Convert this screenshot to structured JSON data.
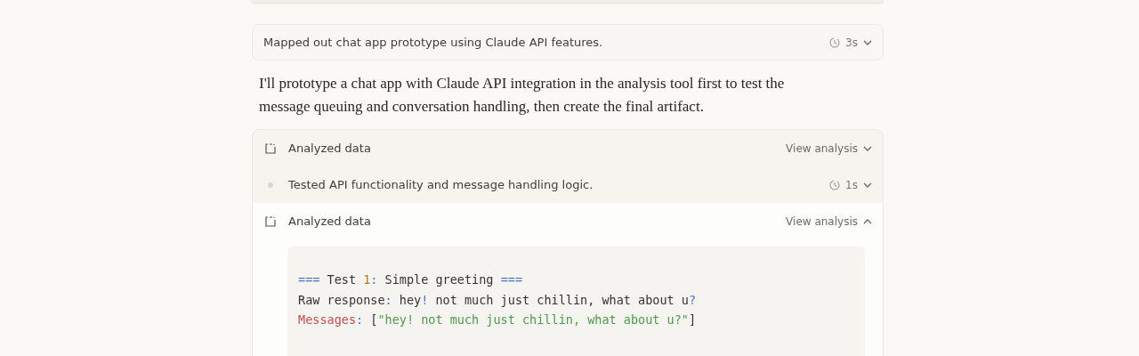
{
  "thinking": {
    "summary": "Mapped out chat app prototype using Claude API features.",
    "duration": "3s",
    "expanded": false
  },
  "message": "I'll prototype a chat app with Claude API integration in the analysis tool first to test the message queuing and conversation handling, then create the final artifact.",
  "steps": [
    {
      "kind": "analysis",
      "label": "Analyzed data",
      "action": "View analysis",
      "expanded": false
    },
    {
      "kind": "thought",
      "label": "Tested API functionality and message handling logic.",
      "duration": "1s",
      "expanded": false
    },
    {
      "kind": "analysis",
      "label": "Analyzed data",
      "action": "View analysis",
      "expanded": true
    }
  ],
  "output": [
    [
      {
        "kind": "op",
        "text": "==="
      },
      {
        "kind": "plain",
        "text": " Test "
      },
      {
        "kind": "number",
        "text": "1"
      },
      {
        "kind": "op",
        "text": ":"
      },
      {
        "kind": "plain",
        "text": " Simple greeting "
      },
      {
        "kind": "op",
        "text": "==="
      }
    ],
    [
      {
        "kind": "plain",
        "text": "Raw response"
      },
      {
        "kind": "op",
        "text": ":"
      },
      {
        "kind": "plain",
        "text": " hey"
      },
      {
        "kind": "op",
        "text": "!"
      },
      {
        "kind": "plain",
        "text": " not much just chillin, what about u"
      },
      {
        "kind": "op",
        "text": "?"
      }
    ],
    [
      {
        "kind": "key",
        "text": "Messages"
      },
      {
        "kind": "op",
        "text": ":"
      },
      {
        "kind": "plain",
        "text": " ["
      },
      {
        "kind": "string",
        "text": "\"hey! not much just chillin, what about u?\""
      },
      {
        "kind": "plain",
        "text": "]"
      }
    ]
  ]
}
